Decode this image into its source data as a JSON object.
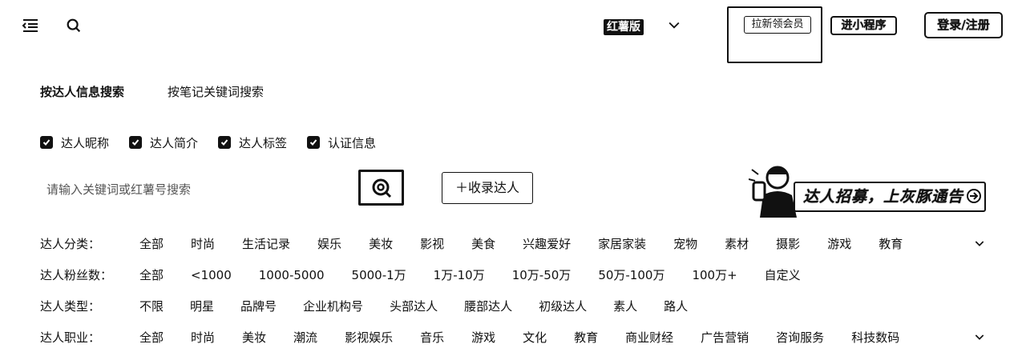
{
  "header": {
    "menu_icon": "menu-icon",
    "search_icon": "search-icon",
    "edition_badge": "红薯版",
    "invite_button": "拉新领会员",
    "miniapp_button": "进小程序",
    "login_button": "登录/注册"
  },
  "search_modes": {
    "by_influencer": "按达人信息搜索",
    "by_keyword": "按笔记关键词搜索"
  },
  "search_fields": [
    {
      "label": "达人昵称",
      "checked": true
    },
    {
      "label": "达人简介",
      "checked": true
    },
    {
      "label": "达人标签",
      "checked": true
    },
    {
      "label": "认证信息",
      "checked": true
    }
  ],
  "search": {
    "placeholder": "请输入关键词或红薯号搜索",
    "value": "",
    "collect_button": "＋收录达人"
  },
  "banner": {
    "text": "达人招募，上灰豚通告"
  },
  "filters": {
    "category": {
      "label": "达人分类：",
      "options": [
        "全部",
        "时尚",
        "生活记录",
        "娱乐",
        "美妆",
        "影视",
        "美食",
        "兴趣爱好",
        "家居家装",
        "宠物",
        "素材",
        "摄影",
        "游戏",
        "教育"
      ]
    },
    "fans": {
      "label": "达人粉丝数：",
      "options": [
        "全部",
        "<1000",
        "1000-5000",
        "5000-1万",
        "1万-10万",
        "10万-50万",
        "50万-100万",
        "100万+",
        "自定义"
      ]
    },
    "type": {
      "label": "达人类型：",
      "options": [
        "不限",
        "明星",
        "品牌号",
        "企业机构号",
        "头部达人",
        "腰部达人",
        "初级达人",
        "素人",
        "路人"
      ]
    },
    "profession": {
      "label": "达人职业：",
      "options": [
        "全部",
        "时尚",
        "美妆",
        "潮流",
        "影视娱乐",
        "音乐",
        "游戏",
        "文化",
        "教育",
        "商业财经",
        "广告营销",
        "咨询服务",
        "科技数码"
      ]
    }
  }
}
